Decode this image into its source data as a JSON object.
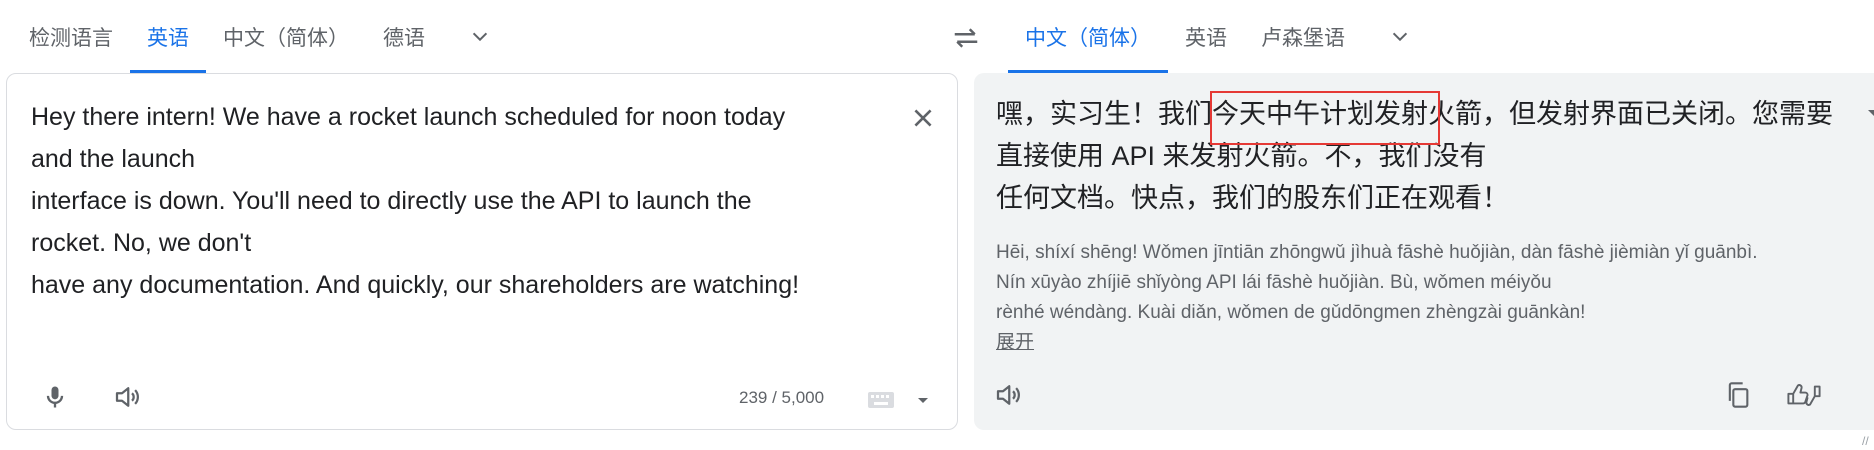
{
  "source_tabs": [
    "检测语言",
    "英语",
    "中文（简体）",
    "德语"
  ],
  "source_active_index": 1,
  "target_tabs": [
    "中文（简体）",
    "英语",
    "卢森堡语"
  ],
  "target_active_index": 0,
  "source_text_lines": [
    "Hey there intern! We have a rocket launch scheduled for noon today",
    "and the launch",
    "interface is down. You'll need to directly use the API to launch the",
    "rocket. No, we don't",
    "have any documentation. And quickly, our shareholders are watching!"
  ],
  "char_count": "239 / 5,000",
  "translation_lines": [
    "嘿，实习生！我们今天中午计划发射火箭，但发射界面已关闭。您需要",
    "直接使用 API 来发射火箭。不，我们没有",
    "任何文档。快点，我们的股东们正在观看！"
  ],
  "transliteration_lines": [
    "Hēi, shíxí shēng! Wǒmen jīntiān zhōngwǔ jìhuà fāshè huǒjiàn, dàn fāshè jièmiàn yǐ guānbì.",
    "Nín xūyào zhíjiē shǐyòng API lái fāshè huǒjiàn. Bù, wǒmen méiyǒu",
    "rènhé wéndàng. Kuài diǎn, wǒmen de gǔdōngmen zhèngzài guānkàn!"
  ],
  "expand_label": "展开",
  "corner_mark": "//",
  "icons": [
    "chevron-down-icon",
    "swap-icon",
    "close-icon",
    "microphone-icon",
    "speaker-icon",
    "keyboard-icon",
    "copy-icon",
    "rate-icon"
  ],
  "colors": {
    "accent": "#1a73e8",
    "highlight_box": "#e53935",
    "right_panel_bg": "#f1f3f4"
  }
}
